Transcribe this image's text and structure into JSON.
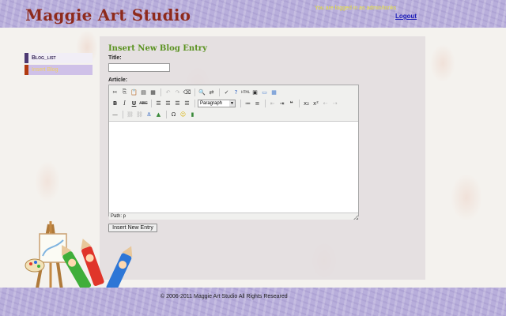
{
  "header": {
    "site_title": "Maggie Art Studio",
    "login_note": "You are logged in as admin/tonks",
    "logout_label": "Logout"
  },
  "menu": {
    "items": [
      {
        "label": "Blog_list"
      },
      {
        "label": "Insert Blog"
      }
    ]
  },
  "form": {
    "page_title": "Insert New Blog Entry",
    "title_label": "Title:",
    "title_value": "",
    "article_label": "Article:",
    "editor": {
      "format_value": "Paragraph",
      "status_path": "Path: p"
    },
    "submit_label": "Insert New Entry"
  },
  "footer": {
    "copyright": "© 2006-2011 Maggie Art Studio All Rights Researed"
  },
  "icons": {
    "toolbar_row1": [
      "cut-icon",
      "copy-icon",
      "paste-icon",
      "paste-text-icon",
      "paste-word-icon",
      "undo-icon",
      "redo-icon",
      "cleanup-icon",
      "find-icon",
      "replace-icon",
      "spellcheck-icon",
      "help-icon",
      "html-icon",
      "image-icon",
      "media-icon",
      "table-icon"
    ],
    "toolbar_row2": [
      "bold-icon",
      "italic-icon",
      "underline-icon",
      "strikethrough-icon",
      "align-left-icon",
      "align-center-icon",
      "align-right-icon",
      "justify-icon",
      "unordered-list-icon",
      "ordered-list-icon",
      "outdent-icon",
      "indent-icon",
      "blockquote-icon",
      "subscript-icon",
      "superscript-icon",
      "rtl-icon",
      "ltr-icon"
    ],
    "toolbar_row3": [
      "horizontal-rule-icon",
      "link-icon",
      "unlink-icon",
      "anchor-icon",
      "image-insert-icon",
      "charmap-icon",
      "emoticon-icon",
      "media-insert-icon"
    ]
  },
  "colors": {
    "band": "#b8aedb",
    "title": "#8e2a1c",
    "page_title": "#5a9220",
    "login_note": "#e8e23a"
  }
}
